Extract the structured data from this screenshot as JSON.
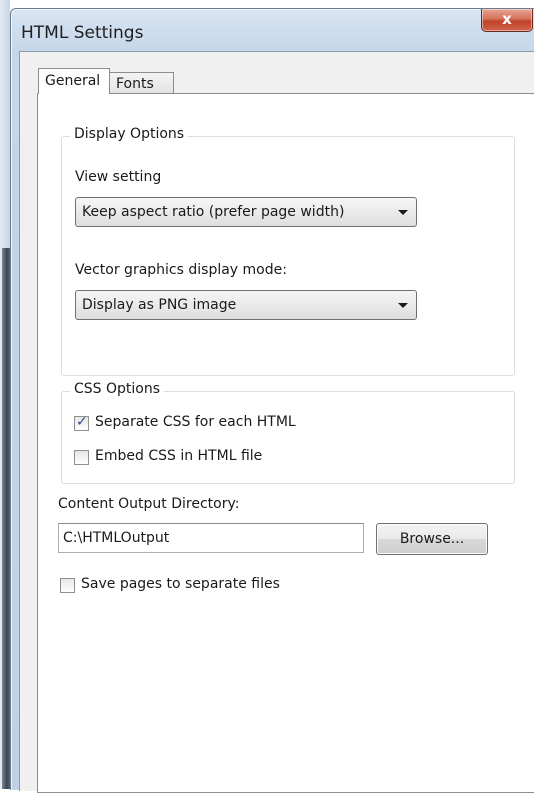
{
  "window": {
    "title": "HTML Settings",
    "close_glyph": "x"
  },
  "tabs": [
    {
      "label": "General",
      "active": true
    },
    {
      "label": "Fonts",
      "active": false
    }
  ],
  "display_options": {
    "title": "Display Options",
    "view_setting_label": "View setting",
    "view_setting_value": "Keep aspect ratio (prefer page width)",
    "vector_label": "Vector graphics display mode:",
    "vector_value": "Display as PNG image"
  },
  "css_options": {
    "title": "CSS Options",
    "separate_label": "Separate CSS for each HTML",
    "separate_checked": true,
    "embed_label": "Embed CSS in HTML file",
    "embed_checked": false
  },
  "output": {
    "dir_label": "Content Output Directory:",
    "dir_value": "C:\\HTMLOutput",
    "browse_label": "Browse..."
  },
  "save_pages": {
    "label": "Save pages to separate files",
    "checked": false
  },
  "icons": [
    "close-icon",
    "dropdown-arrow-icon",
    "checkbox-icon"
  ]
}
